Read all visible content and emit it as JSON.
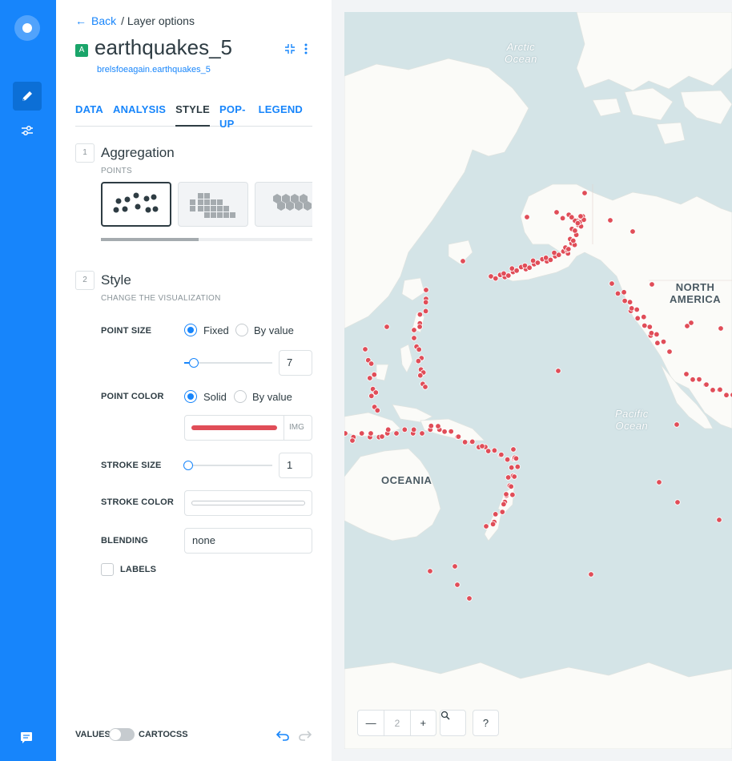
{
  "nav": {
    "items": [
      {
        "icon": "logo-icon"
      },
      {
        "icon": "pencil-icon",
        "active": true
      },
      {
        "icon": "sliders-icon"
      },
      {
        "icon": "chat-icon"
      }
    ]
  },
  "header": {
    "back_label": "Back",
    "breadcrumb": "/ Layer options",
    "layer_letter": "A",
    "layer_name": "earthquakes_5",
    "layer_source": "brelsfoeagain.earthquakes_5"
  },
  "tabs": [
    {
      "label": "DATA",
      "active": false
    },
    {
      "label": "ANALYSIS",
      "active": false
    },
    {
      "label": "STYLE",
      "active": true
    },
    {
      "label": "POP-UP",
      "active": false
    },
    {
      "label": "LEGEND",
      "active": false
    }
  ],
  "aggregation": {
    "step": "1",
    "title": "Aggregation",
    "subtitle": "POINTS",
    "options": [
      "points",
      "squares",
      "hexabins"
    ],
    "selected": "points"
  },
  "style": {
    "step": "2",
    "title": "Style",
    "subtitle": "CHANGE THE VISUALIZATION",
    "point_size": {
      "label": "POINT SIZE",
      "opt_fixed": "Fixed",
      "opt_value": "By value",
      "selected": "Fixed",
      "value": "7",
      "slider_level": 0.07
    },
    "point_color": {
      "label": "POINT COLOR",
      "opt_solid": "Solid",
      "opt_value": "By value",
      "selected": "Solid",
      "color": "#e04d58",
      "img_label": "IMG"
    },
    "stroke_size": {
      "label": "STROKE SIZE",
      "value": "1",
      "slider_level": 0.01
    },
    "stroke_color": {
      "label": "STROKE COLOR",
      "color": "#ffffff"
    },
    "blending": {
      "label": "BLENDING",
      "value": "none"
    },
    "labels": {
      "label": "LABELS",
      "checked": false
    }
  },
  "footer": {
    "values_label": "VALUES",
    "cartocss_label": "CARTOCSS",
    "toggle_on": false
  },
  "map": {
    "labels": [
      {
        "text": "NORTH\nAMERICA",
        "kind": "continent"
      },
      {
        "text": "OCEANIA",
        "kind": "continent"
      },
      {
        "text": "Arctic\nOcean",
        "kind": "ocean"
      },
      {
        "text": "Pacific\nOcean",
        "kind": "ocean"
      }
    ],
    "zoom_level": "2",
    "point_color": "#e04d58"
  }
}
